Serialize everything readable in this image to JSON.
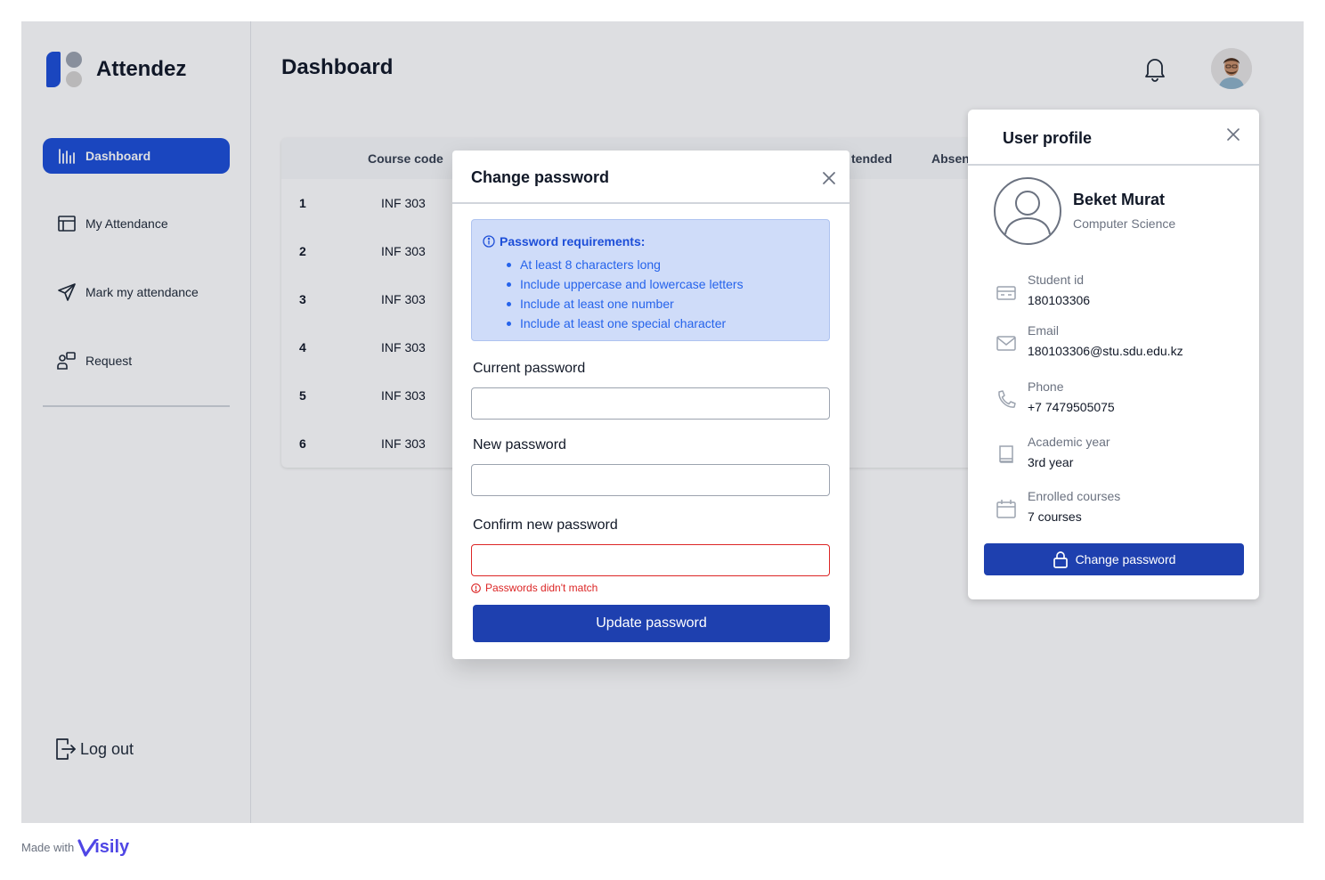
{
  "app": {
    "name": "Attendez"
  },
  "sidebar": {
    "items": [
      {
        "label": "Dashboard",
        "icon": "bar-chart-icon",
        "active": true
      },
      {
        "label": "My Attendance",
        "icon": "calendar-table-icon"
      },
      {
        "label": "Mark my attendance",
        "icon": "send-icon"
      },
      {
        "label": "Request",
        "icon": "request-icon"
      }
    ],
    "logout_label": "Log out"
  },
  "header": {
    "title": "Dashboard"
  },
  "table": {
    "columns": [
      "Course code",
      "tended",
      "Absen"
    ],
    "rows": [
      {
        "num": "1",
        "code": "INF 303"
      },
      {
        "num": "2",
        "code": "INF 303"
      },
      {
        "num": "3",
        "code": "INF 303"
      },
      {
        "num": "4",
        "code": "INF 303"
      },
      {
        "num": "5",
        "code": "INF 303"
      },
      {
        "num": "6",
        "code": "INF 303"
      }
    ]
  },
  "modal": {
    "title": "Change password",
    "requirements": {
      "title": "Password requirements:",
      "items": [
        "At least 8 characters long",
        "Include uppercase and lowercase letters",
        "Include at least one number",
        "Include at least one special character"
      ]
    },
    "fields": {
      "current_label": "Current password",
      "current_value": "",
      "new_label": "New password",
      "new_value": "",
      "confirm_label": "Confirm new password",
      "confirm_value": ""
    },
    "error": "Passwords didn't match",
    "submit_label": "Update password"
  },
  "profile": {
    "title": "User profile",
    "name": "Beket Murat",
    "department": "Computer Science",
    "info": [
      {
        "label": "Student id",
        "value": "180103306",
        "icon": "id-card-icon"
      },
      {
        "label": "Email",
        "value": "180103306@stu.sdu.edu.kz",
        "icon": "mail-icon"
      },
      {
        "label": "Phone",
        "value": "+7 7479505075",
        "icon": "phone-icon"
      },
      {
        "label": "Academic year",
        "value": "3rd year",
        "icon": "book-icon"
      },
      {
        "label": "Enrolled courses",
        "value": "7 courses",
        "icon": "calendar-icon"
      }
    ],
    "change_password_label": "Change password"
  },
  "footer": {
    "made_with": "Made with",
    "brand": "Visily"
  },
  "colors": {
    "accent": "#1d4ed8",
    "button": "#1e40af",
    "error": "#dc2626",
    "info_bg": "#cfdcf9"
  }
}
